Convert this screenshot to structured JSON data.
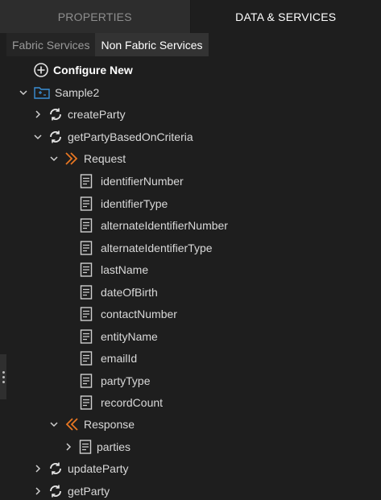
{
  "top_tabs": [
    {
      "label": "PROPERTIES"
    },
    {
      "label": "DATA & SERVICES"
    }
  ],
  "sub_tabs": [
    {
      "label": "Fabric Services"
    },
    {
      "label": "Non Fabric Services"
    }
  ],
  "tree": {
    "configure_new": "Configure New",
    "root": "Sample2",
    "services": {
      "create_party": "createParty",
      "get_party_based": "getPartyBasedOnCriteria",
      "update_party": "updateParty",
      "get_party": "getParty"
    },
    "request": {
      "label": "Request",
      "fields": [
        "identifierNumber",
        "identifierType",
        "alternateIdentifierNumber",
        "alternateIdentifierType",
        "lastName",
        "dateOfBirth",
        "contactNumber",
        "entityName",
        "emailId",
        "partyType",
        "recordCount"
      ]
    },
    "response": {
      "label": "Response",
      "fields": [
        "parties"
      ]
    }
  },
  "colors": {
    "accent_orange": "#e87722",
    "folder_blue": "#3a8fd6",
    "background": "#1e1e1e"
  }
}
